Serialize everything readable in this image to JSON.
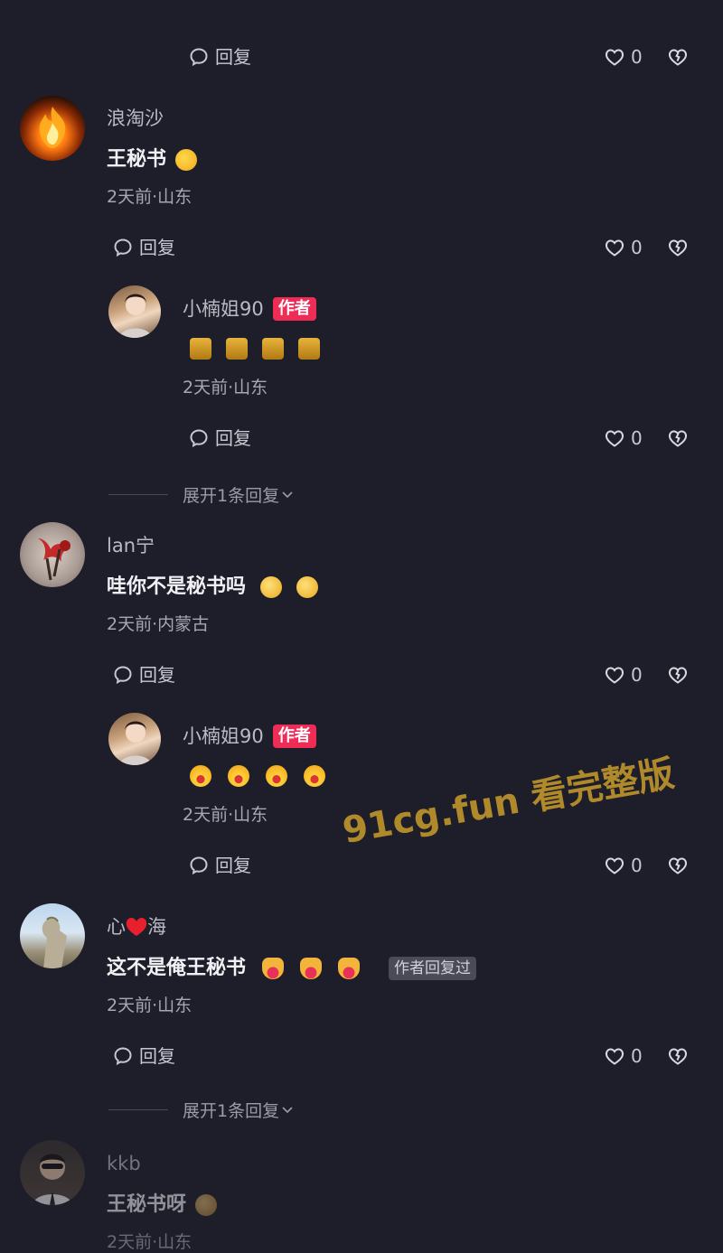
{
  "ui": {
    "reply_label": "回复",
    "author_badge": "作者",
    "author_replied_tag": "作者回复过",
    "expand_label": "展开1条回复",
    "watermark": "91cg.fun 看完整版"
  },
  "top_actions": {
    "like_count": "0"
  },
  "comments": [
    {
      "username": "浪淘沙",
      "text": "王秘书",
      "meta": "2天前·山东",
      "like_count": "0",
      "reply": {
        "username": "小楠姐90",
        "meta": "2天前·山东",
        "like_count": "0"
      }
    },
    {
      "username": "lan宁",
      "text": "哇你不是秘书吗",
      "meta": "2天前·内蒙古",
      "like_count": "0",
      "reply": {
        "username": "小楠姐90",
        "meta": "2天前·山东",
        "like_count": "0"
      }
    },
    {
      "username_prefix": "心",
      "username_suffix": "海",
      "text": "这不是俺王秘书",
      "meta": "2天前·山东",
      "like_count": "0"
    },
    {
      "username": "kkb",
      "text": "王秘书呀",
      "meta": "2天前·山东"
    }
  ],
  "colors": {
    "background": "#1d1e29",
    "author_badge": "#ee2c55",
    "watermark": "#b08a2a"
  },
  "icons": [
    "comment-bubble-icon",
    "heart-outline-icon",
    "broken-heart-icon",
    "chevron-down-icon",
    "red-heart-icon"
  ]
}
